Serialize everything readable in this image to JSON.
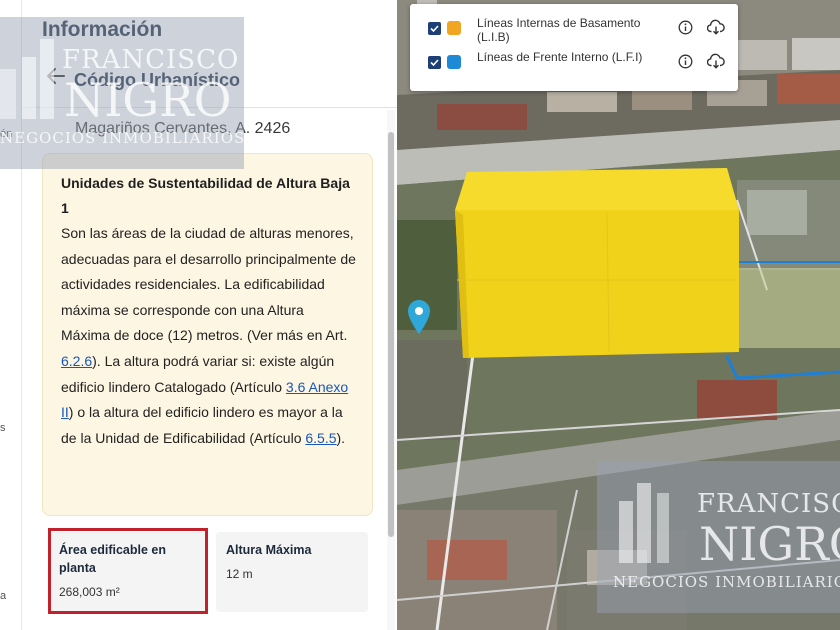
{
  "sidebar_strip": {
    "fragment_top": "ón",
    "fragment_mid": "s",
    "fragment_bottom": "a"
  },
  "panel": {
    "title": "Información",
    "subtitle": "Código Urbanístico",
    "back_icon": "arrow-left-icon",
    "address": "Magariños Cervantes, A. 2426",
    "info_card": {
      "title": "Unidades de Sustentabilidad de Altura Baja 1",
      "text_1": "Son las áreas de la ciudad de alturas menores, adecuadas para el desarrollo principalmente de actividades residenciales. La edificabilidad máxima se corresponde con una Altura Máxima de doce (12) metros. (Ver más en Art. ",
      "link_1": "6.2.6",
      "text_2": "). La altura podrá variar si: existe algún edificio lindero Catalogado (Artículo ",
      "link_2": "3.6 Anexo II",
      "text_3": ") o la altura del edificio lindero es mayor a la de la Unidad de Edificabilidad (Artículo ",
      "link_3": "6.5.5",
      "text_4": ")."
    },
    "stats": [
      {
        "label": "Área edificable en planta",
        "value": "268,003 m²"
      },
      {
        "label": "Altura Máxima",
        "value": "12 m"
      }
    ]
  },
  "map": {
    "legend": [
      {
        "label": "Líneas Internas de Basamento (L.I.B)",
        "color": "#f0a623",
        "checked": true,
        "info_icon": "info-icon",
        "download_icon": "cloud-download-icon"
      },
      {
        "label": "Líneas de Frente Interno (L.F.I)",
        "color": "#1e8ad6",
        "checked": true,
        "info_icon": "info-icon",
        "download_icon": "cloud-download-icon"
      }
    ],
    "location_marker_icon": "location-pin-icon",
    "building_color": "#f2d41a",
    "outline_color": "#1e7fd6"
  },
  "watermark": {
    "line1": "FRANCISCO",
    "line2": "NIGRO",
    "line3": "NEGOCIOS INMOBILIARIOS"
  }
}
